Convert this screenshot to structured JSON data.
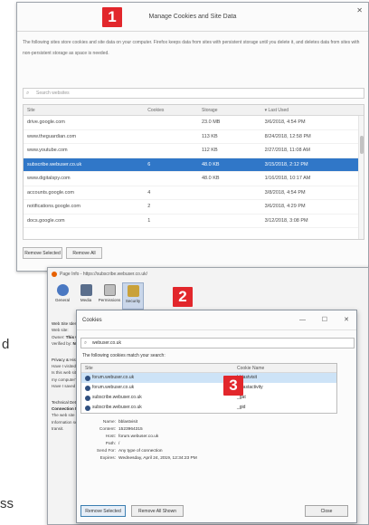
{
  "side_letters": {
    "d": "d",
    "ss": "ss"
  },
  "dialog1": {
    "title": "Manage Cookies and Site Data",
    "badge": "1",
    "close": "✕",
    "description": "The following sites store cookies and site data on your computer. Firefox keeps data from sites with persistent storage until you delete it, and deletes data from sites with non-persistent storage as space is needed.",
    "search_placeholder": "Search websites",
    "columns": [
      "Site",
      "Cookies",
      "Storage",
      "Last Used"
    ],
    "rows": [
      {
        "site": "drive.google.com",
        "cookies": "",
        "storage": "23.0 MB",
        "last": "3/6/2018, 4:54 PM",
        "selected": false
      },
      {
        "site": "www.theguardian.com",
        "cookies": "",
        "storage": "113 KB",
        "last": "8/24/2018, 12:58 PM",
        "selected": false
      },
      {
        "site": "www.youtube.com",
        "cookies": "",
        "storage": "112 KB",
        "last": "2/27/2018, 11:08 AM",
        "selected": false
      },
      {
        "site": "subscribe.webuser.co.uk",
        "cookies": "6",
        "storage": "48.0 KB",
        "last": "3/15/2018, 2:12 PM",
        "selected": true
      },
      {
        "site": "www.digitalspy.com",
        "cookies": "",
        "storage": "48.0 KB",
        "last": "1/16/2018, 10:17 AM",
        "selected": false
      },
      {
        "site": "accounts.google.com",
        "cookies": "4",
        "storage": "",
        "last": "3/8/2018, 4:54 PM",
        "selected": false
      },
      {
        "site": "notifications.google.com",
        "cookies": "2",
        "storage": "",
        "last": "3/6/2018, 4:29 PM",
        "selected": false
      },
      {
        "site": "docs.google.com",
        "cookies": "1",
        "storage": "",
        "last": "3/12/2018, 3:08 PM",
        "selected": false
      }
    ],
    "remove_selected": "Remove Selected",
    "remove_all": "Remove All"
  },
  "dialog2": {
    "title": "Page Info - https://subscribe.webuser.co.uk/",
    "badge": "2",
    "tabs": [
      {
        "label": "General",
        "color": "#4a78c2"
      },
      {
        "label": "Media",
        "color": "#5a6e8c"
      },
      {
        "label": "Permissions",
        "color": "#7e7e7e"
      },
      {
        "label": "Security",
        "color": "#c9a13a"
      }
    ],
    "left": {
      "identity_heading": "Web Site Identity",
      "website_k": "Web site:",
      "owner_k": "Owner:",
      "owner_v": "This web",
      "verified_k": "Verified by:",
      "verified_v": "Not spe",
      "privacy_heading": "Privacy & History",
      "q1": "Have I visited this web",
      "q2": "Is this web site storing",
      "q2b": "my computer?",
      "q3": "Have I saved any passw",
      "tech_heading": "Technical Details",
      "conn": "Connection Not Encryp",
      "t1": "The web site subscribe",
      "t2": "Information sent over th",
      "t3": "transit."
    }
  },
  "dialog3": {
    "title": "Cookies",
    "badge": "3",
    "minimize": "—",
    "maximize": "☐",
    "close": "✕",
    "search_value": "webuser.co.uk",
    "match_text": "The following cookies match your search:",
    "columns": [
      "Site",
      "Cookie Name"
    ],
    "rows": [
      {
        "site": "forum.webuser.co.uk",
        "cookie": "bblastvisit",
        "selected": true
      },
      {
        "site": "forum.webuser.co.uk",
        "cookie": "bblastactivity",
        "selected": false
      },
      {
        "site": "subscribe.webuser.co.uk",
        "cookie": "_gat",
        "selected": false
      },
      {
        "site": "subscribe.webuser.co.uk",
        "cookie": "_gid",
        "selected": false
      }
    ],
    "details": [
      {
        "k": "Name:",
        "v": "bblastvisit"
      },
      {
        "k": "Content:",
        "v": "1523964315"
      },
      {
        "k": "Host:",
        "v": "forum.webuser.co.uk"
      },
      {
        "k": "Path:",
        "v": "/"
      },
      {
        "k": "Send For:",
        "v": "Any type of connection"
      },
      {
        "k": "Expires:",
        "v": "Wednesday, April 24, 2019, 12:34:23 PM"
      }
    ],
    "remove_selected": "Remove Selected",
    "remove_all_shown": "Remove All Shown",
    "close_btn": "Close"
  },
  "colors": {
    "badge": "#e2272c",
    "selection": "#3077c8"
  }
}
